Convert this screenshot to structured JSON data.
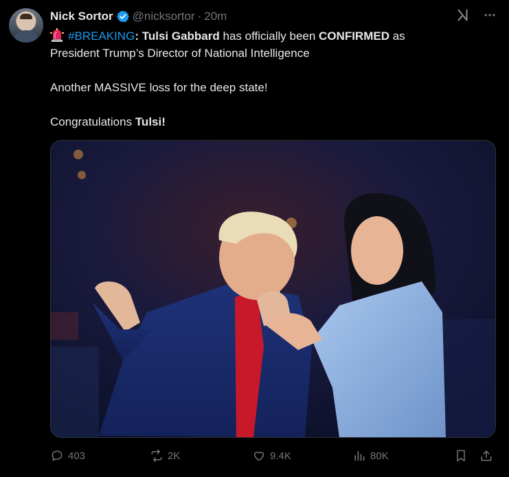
{
  "author": {
    "name": "Nick Sortor",
    "handle": "@nicksortor",
    "separator": "·",
    "time": "20m",
    "verified": true,
    "verified_color": "#1d9bf0",
    "avatar_icon": "avatar-photo"
  },
  "top_icons": [
    "grok-icon",
    "more-icon"
  ],
  "tweet": {
    "line1_hashtag": "#BREAKING",
    "line1_colon": ":",
    "line1_name": "Tulsi Gabbard",
    "line1_mid": " has officially been ",
    "line1_confirmed": "CONFIRMED",
    "line1_end": " as",
    "line2": "President Trump’s Director of National Intelligence",
    "line3": "Another MASSIVE loss for the deep state!",
    "line4_start": "Congratulations ",
    "line4_name": "Tulsi!",
    "emoji_icon": "police-light-icon"
  },
  "media": {
    "type": "photo",
    "subject": "two-people-on-stage-photo"
  },
  "actions": {
    "replies": "403",
    "reposts": "2K",
    "likes": "9.4K",
    "views": "80K"
  },
  "colors": {
    "background": "#000000",
    "text": "#e7e9ea",
    "muted": "#71767b",
    "accent": "#1d9bf0"
  }
}
